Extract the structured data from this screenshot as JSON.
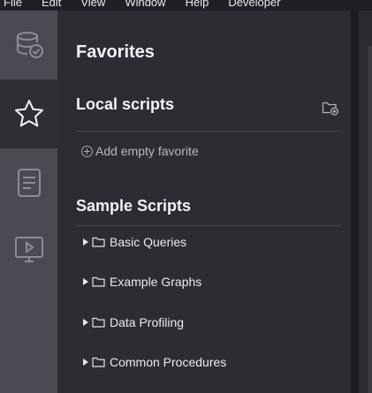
{
  "menubar": {
    "items": [
      "File",
      "Edit",
      "View",
      "Window",
      "Help",
      "Developer"
    ]
  },
  "activity_bar": {
    "items": [
      {
        "icon": "database-check-icon",
        "active": false
      },
      {
        "icon": "star-icon",
        "active": true
      },
      {
        "icon": "document-icon",
        "active": false
      },
      {
        "icon": "play-screen-icon",
        "active": false
      }
    ]
  },
  "panel": {
    "title": "Favorites",
    "local": {
      "heading": "Local scripts",
      "add_folder_icon": "folder-add-icon",
      "add_empty_label": "Add empty favorite"
    },
    "samples": {
      "heading": "Sample Scripts",
      "folders": [
        {
          "label": "Basic Queries"
        },
        {
          "label": "Example Graphs"
        },
        {
          "label": "Data Profiling"
        },
        {
          "label": "Common Procedures"
        }
      ]
    }
  },
  "colors": {
    "activity_bg": "#4a4a52",
    "activity_active_bg": "#2e2f35",
    "panel_bg": "#2c2d33",
    "text": "#f2f2f2",
    "muted_text": "#b9bac0"
  }
}
